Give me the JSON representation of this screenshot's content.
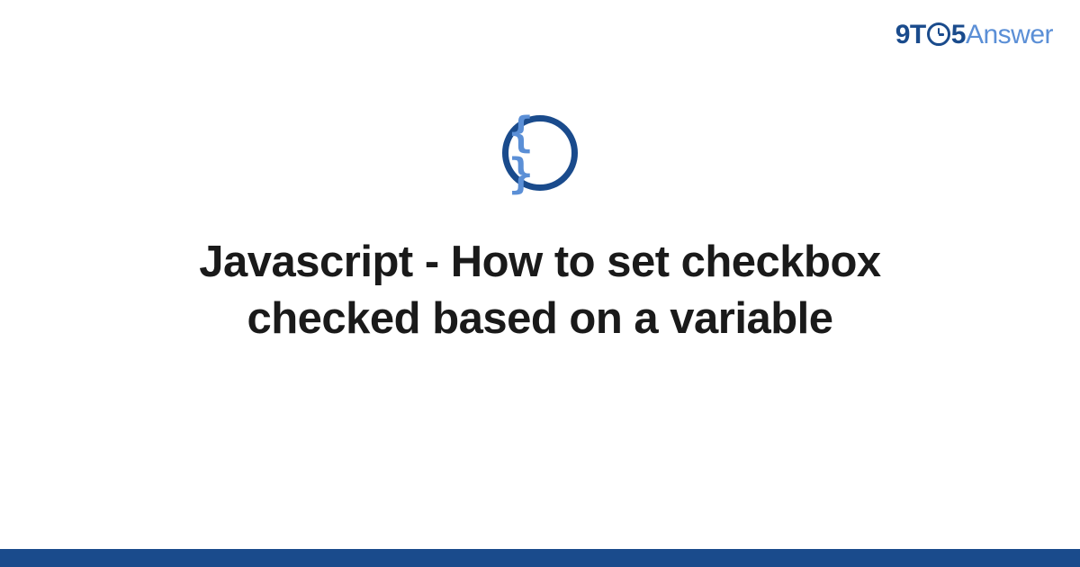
{
  "logo": {
    "part_9t": "9T",
    "part_5": "5",
    "part_answer": "Answer"
  },
  "icon": {
    "glyph": "{ }"
  },
  "title": "Javascript - How to set checkbox checked based on a variable",
  "colors": {
    "brand_dark": "#1a4b8c",
    "brand_light": "#5b8fd6",
    "text": "#1a1a1a"
  }
}
